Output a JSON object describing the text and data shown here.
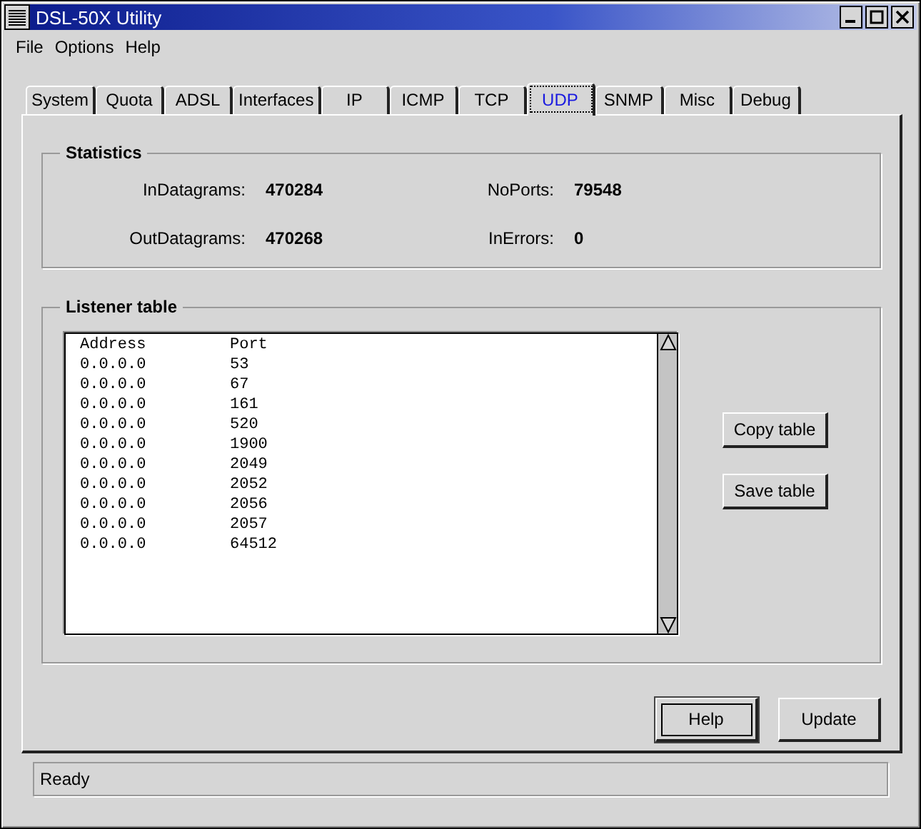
{
  "window": {
    "title": "DSL-50X Utility"
  },
  "menu": [
    "File",
    "Options",
    "Help"
  ],
  "tabs": [
    {
      "label": "System",
      "selected": false
    },
    {
      "label": "Quota",
      "selected": false
    },
    {
      "label": "ADSL",
      "selected": false
    },
    {
      "label": "Interfaces",
      "selected": false
    },
    {
      "label": "IP",
      "selected": false
    },
    {
      "label": "ICMP",
      "selected": false
    },
    {
      "label": "TCP",
      "selected": false
    },
    {
      "label": "UDP",
      "selected": true
    },
    {
      "label": "SNMP",
      "selected": false
    },
    {
      "label": "Misc",
      "selected": false
    },
    {
      "label": "Debug",
      "selected": false
    }
  ],
  "statistics": {
    "title": "Statistics",
    "fields": [
      {
        "label": "InDatagrams:",
        "value": "470284"
      },
      {
        "label": "NoPorts:",
        "value": "79548"
      },
      {
        "label": "OutDatagrams:",
        "value": "470268"
      },
      {
        "label": "InErrors:",
        "value": "0"
      }
    ]
  },
  "listener_table": {
    "title": "Listener table",
    "columns": [
      "Address",
      "Port"
    ],
    "rows": [
      [
        "0.0.0.0",
        "53"
      ],
      [
        "0.0.0.0",
        "67"
      ],
      [
        "0.0.0.0",
        "161"
      ],
      [
        "0.0.0.0",
        "520"
      ],
      [
        "0.0.0.0",
        "1900"
      ],
      [
        "0.0.0.0",
        "2049"
      ],
      [
        "0.0.0.0",
        "2052"
      ],
      [
        "0.0.0.0",
        "2056"
      ],
      [
        "0.0.0.0",
        "2057"
      ],
      [
        "0.0.0.0",
        "64512"
      ]
    ],
    "buttons": [
      "Copy table",
      "Save table"
    ]
  },
  "buttons": [
    {
      "label": "Help",
      "default": true
    },
    {
      "label": "Update",
      "default": false
    }
  ],
  "status_bar": "Ready"
}
